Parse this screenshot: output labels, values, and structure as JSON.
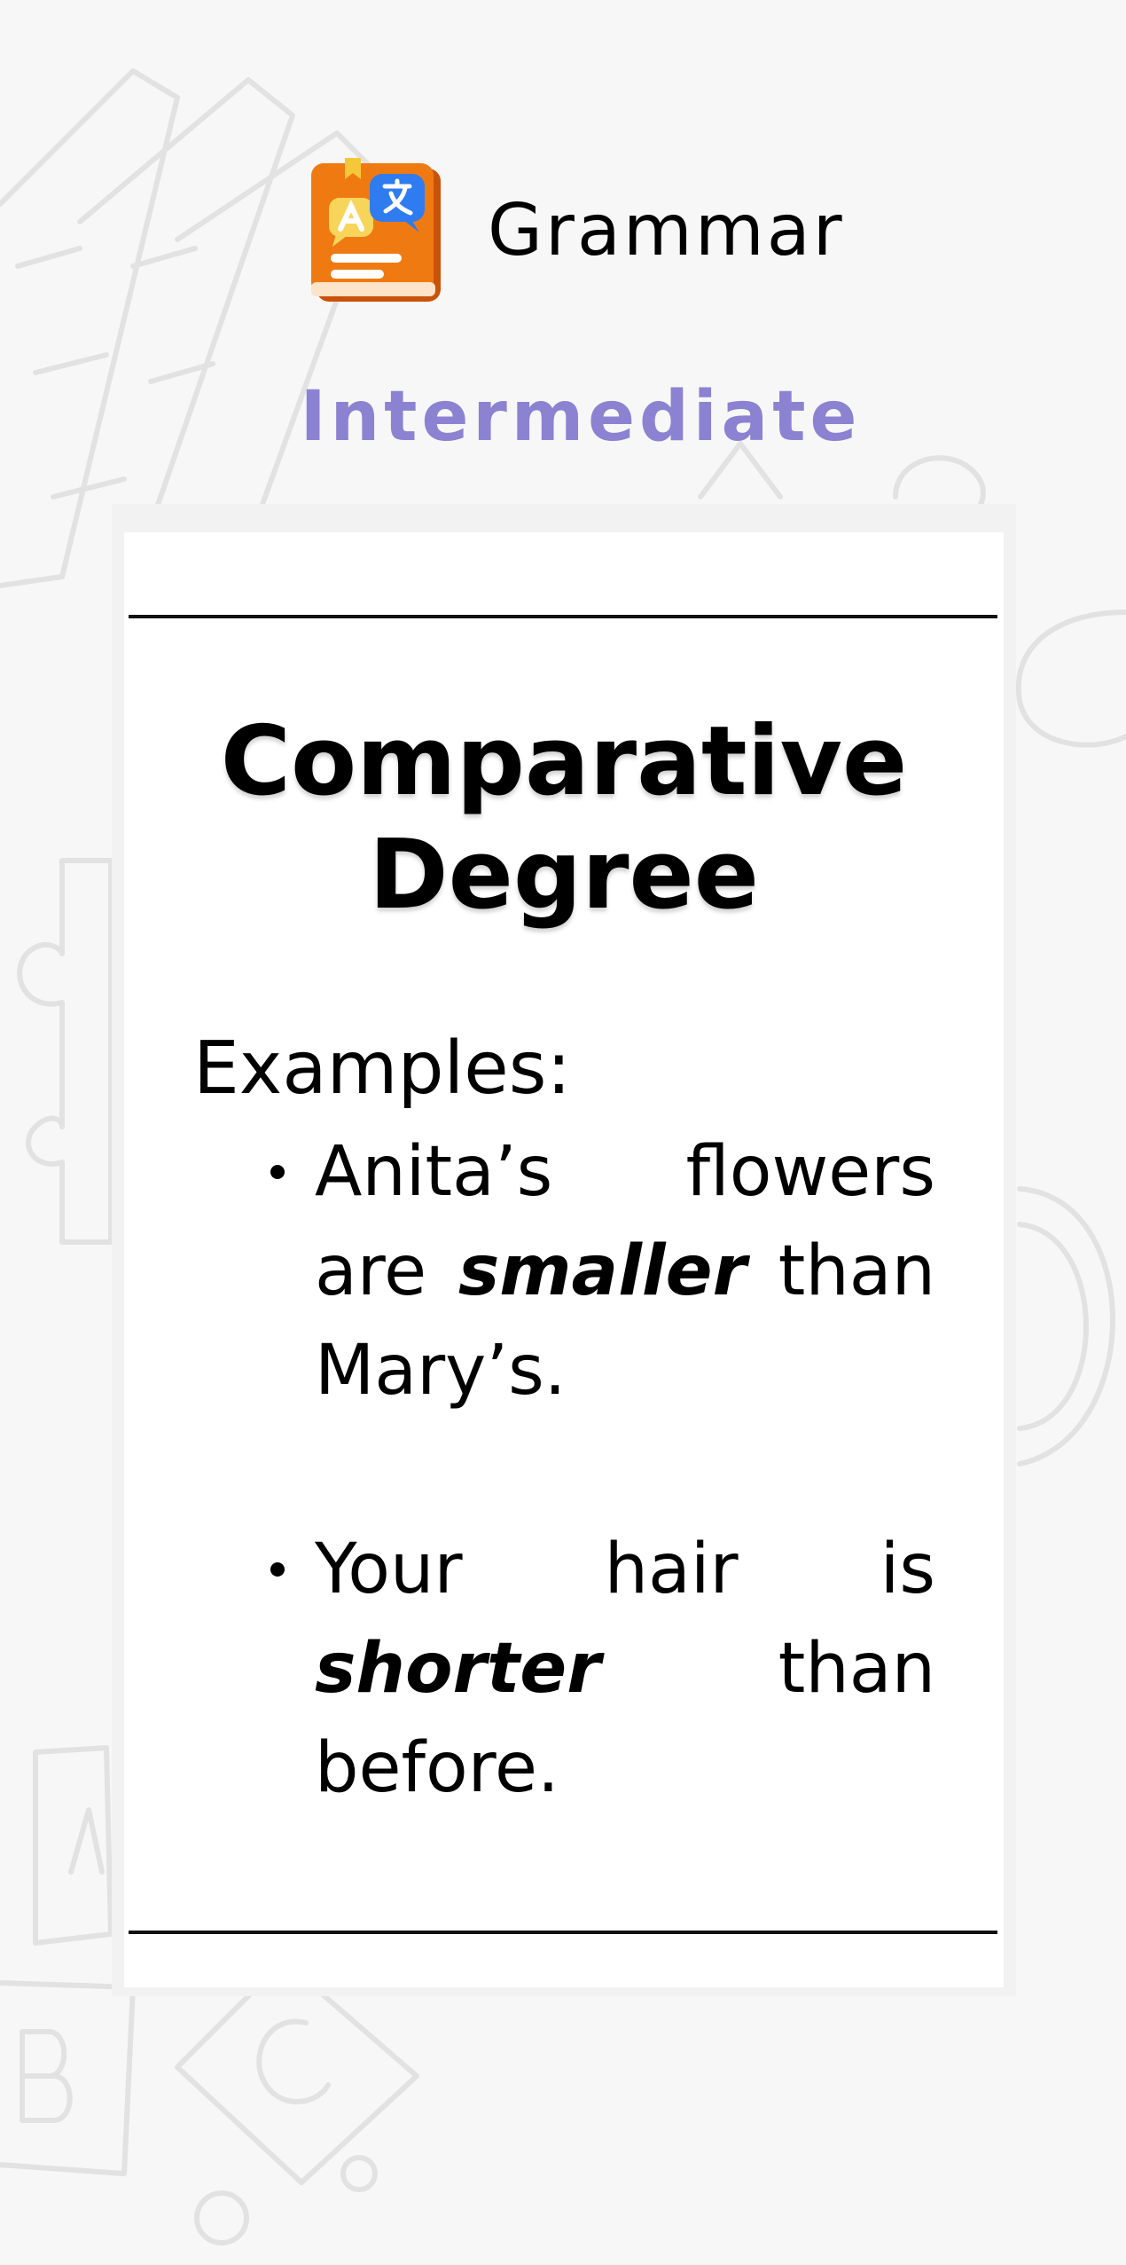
{
  "header": {
    "app_title": "Grammar",
    "level": "Intermediate",
    "logo_icon": "translate-book-icon"
  },
  "lesson": {
    "title_line1": "Comparative",
    "title_line2": "Degree",
    "examples_label": "Examples:",
    "examples": [
      {
        "before": "Anita’s flowers are ",
        "emphasis": "smaller",
        "after": " than Mary’s."
      },
      {
        "before": "Your hair is ",
        "emphasis": "shorter",
        "after": " than before."
      }
    ]
  },
  "colors": {
    "level": "#8c82d2",
    "background": "#f7f7f7",
    "logo_orange": "#f07a12",
    "logo_blue": "#2f7bf0"
  }
}
